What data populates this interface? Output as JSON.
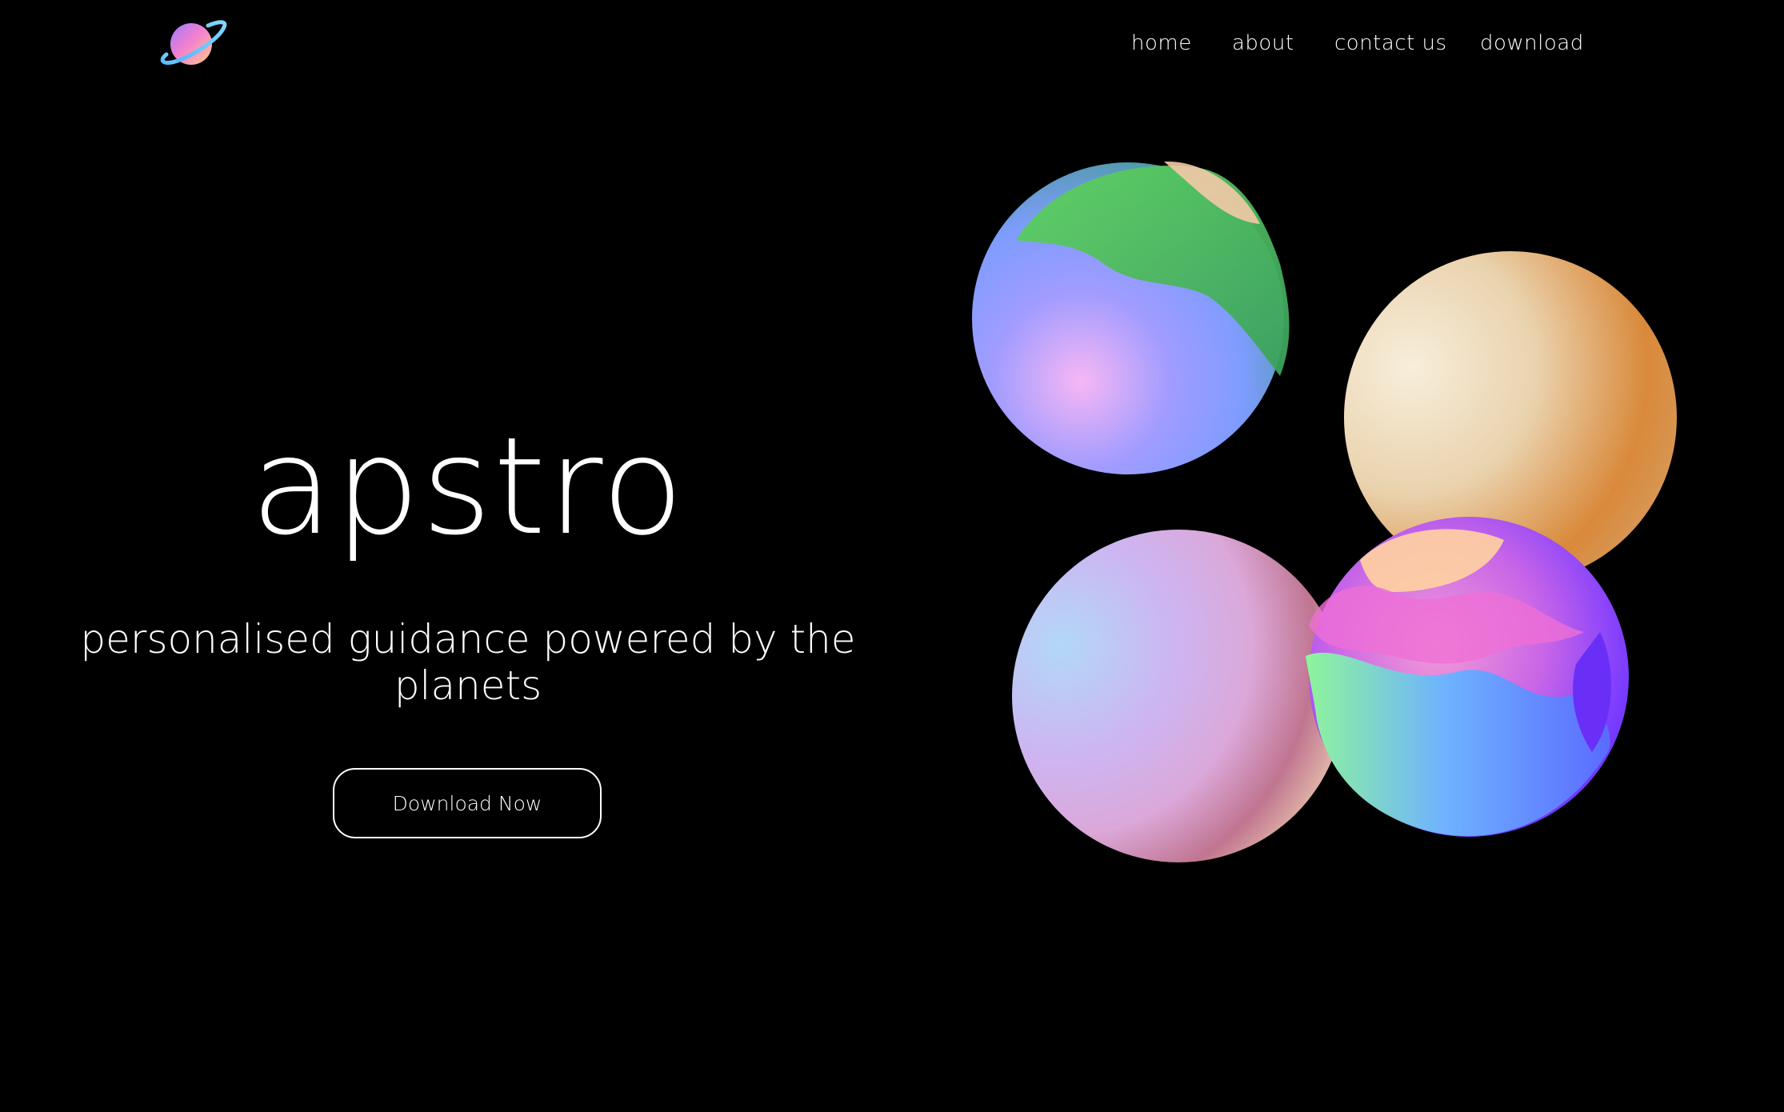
{
  "header": {
    "logo_icon": "planet-logo-icon",
    "nav": {
      "home": "home",
      "about": "about",
      "contact": "contact us",
      "download": "download"
    }
  },
  "hero": {
    "title": "apstro",
    "tagline": "personalised guidance powered by the planets",
    "cta_label": "Download Now"
  },
  "colors": {
    "background": "#000000",
    "text": "#ffffff",
    "planet_green": "#5fd35e",
    "planet_blue": "#7f9cff",
    "planet_pink": "#f6b7f4",
    "planet_orange": "#d9893a",
    "planet_cream": "#f2e4c8",
    "planet_violet": "#7a3cff",
    "planet_magenta": "#ee6fd6"
  }
}
